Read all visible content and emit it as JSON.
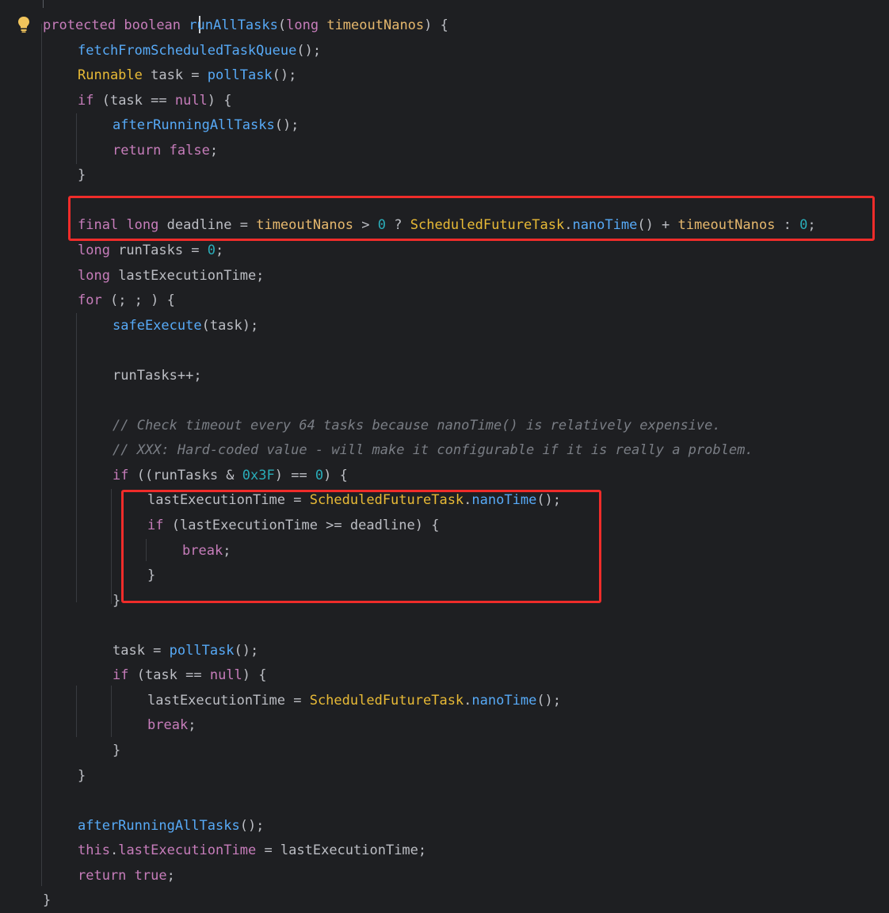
{
  "code_lines": [
    {
      "indent": 0,
      "tokens": [
        [
          "kw2",
          "protected"
        ],
        [
          "plain",
          " "
        ],
        [
          "kw2",
          "boolean"
        ],
        [
          "plain",
          " "
        ],
        [
          "fn",
          "runAllTasks"
        ],
        [
          "plain",
          "("
        ],
        [
          "kw2",
          "long"
        ],
        [
          "plain",
          " "
        ],
        [
          "param",
          "timeoutNanos"
        ],
        [
          "plain",
          ") {"
        ]
      ]
    },
    {
      "indent": 1,
      "tokens": [
        [
          "call",
          "fetchFromScheduledTaskQueue"
        ],
        [
          "plain",
          "();"
        ]
      ]
    },
    {
      "indent": 1,
      "tokens": [
        [
          "type",
          "Runnable"
        ],
        [
          "plain",
          " task = "
        ],
        [
          "call",
          "pollTask"
        ],
        [
          "plain",
          "();"
        ]
      ]
    },
    {
      "indent": 1,
      "tokens": [
        [
          "kw2",
          "if"
        ],
        [
          "plain",
          " (task == "
        ],
        [
          "kw2",
          "null"
        ],
        [
          "plain",
          ") {"
        ]
      ]
    },
    {
      "indent": 2,
      "tokens": [
        [
          "call",
          "afterRunningAllTasks"
        ],
        [
          "plain",
          "();"
        ]
      ]
    },
    {
      "indent": 2,
      "tokens": [
        [
          "kw2",
          "return"
        ],
        [
          "plain",
          " "
        ],
        [
          "kw2",
          "false"
        ],
        [
          "plain",
          ";"
        ]
      ]
    },
    {
      "indent": 1,
      "tokens": [
        [
          "plain",
          "}"
        ]
      ]
    },
    {
      "indent": 1,
      "tokens": []
    },
    {
      "indent": 1,
      "tokens": [
        [
          "kw2",
          "final"
        ],
        [
          "plain",
          " "
        ],
        [
          "kw2",
          "long"
        ],
        [
          "plain",
          " deadline = "
        ],
        [
          "param",
          "timeoutNanos"
        ],
        [
          "plain",
          " > "
        ],
        [
          "num",
          "0"
        ],
        [
          "plain",
          " ? "
        ],
        [
          "type",
          "ScheduledFutureTask"
        ],
        [
          "plain",
          "."
        ],
        [
          "call",
          "nanoTime"
        ],
        [
          "plain",
          "() + "
        ],
        [
          "param",
          "timeoutNanos"
        ],
        [
          "plain",
          " : "
        ],
        [
          "num",
          "0"
        ],
        [
          "plain",
          ";"
        ]
      ]
    },
    {
      "indent": 1,
      "tokens": [
        [
          "kw2",
          "long"
        ],
        [
          "plain",
          " runTasks = "
        ],
        [
          "num",
          "0"
        ],
        [
          "plain",
          ";"
        ]
      ]
    },
    {
      "indent": 1,
      "tokens": [
        [
          "kw2",
          "long"
        ],
        [
          "plain",
          " lastExecutionTime;"
        ]
      ]
    },
    {
      "indent": 1,
      "tokens": [
        [
          "kw2",
          "for"
        ],
        [
          "plain",
          " (; ; ) {"
        ]
      ]
    },
    {
      "indent": 2,
      "tokens": [
        [
          "call",
          "safeExecute"
        ],
        [
          "plain",
          "(task);"
        ]
      ]
    },
    {
      "indent": 2,
      "tokens": []
    },
    {
      "indent": 2,
      "tokens": [
        [
          "plain",
          "runTasks++;"
        ]
      ]
    },
    {
      "indent": 2,
      "tokens": []
    },
    {
      "indent": 2,
      "tokens": [
        [
          "comment",
          "// Check timeout every 64 tasks because nanoTime() is relatively expensive."
        ]
      ]
    },
    {
      "indent": 2,
      "tokens": [
        [
          "comment",
          "// XXX: Hard-coded value - will make it configurable if it is really a problem."
        ]
      ]
    },
    {
      "indent": 2,
      "tokens": [
        [
          "kw2",
          "if"
        ],
        [
          "plain",
          " ((runTasks & "
        ],
        [
          "num",
          "0x3F"
        ],
        [
          "plain",
          ") == "
        ],
        [
          "num",
          "0"
        ],
        [
          "plain",
          ") {"
        ]
      ]
    },
    {
      "indent": 3,
      "tokens": [
        [
          "plain",
          "lastExecutionTime = "
        ],
        [
          "type",
          "ScheduledFutureTask"
        ],
        [
          "plain",
          "."
        ],
        [
          "call",
          "nanoTime"
        ],
        [
          "plain",
          "();"
        ]
      ]
    },
    {
      "indent": 3,
      "tokens": [
        [
          "kw2",
          "if"
        ],
        [
          "plain",
          " (lastExecutionTime >= deadline) {"
        ]
      ]
    },
    {
      "indent": 4,
      "tokens": [
        [
          "kw2",
          "break"
        ],
        [
          "plain",
          ";"
        ]
      ]
    },
    {
      "indent": 3,
      "tokens": [
        [
          "plain",
          "}"
        ]
      ]
    },
    {
      "indent": 2,
      "tokens": [
        [
          "plain",
          "}"
        ]
      ]
    },
    {
      "indent": 2,
      "tokens": []
    },
    {
      "indent": 2,
      "tokens": [
        [
          "plain",
          "task = "
        ],
        [
          "call",
          "pollTask"
        ],
        [
          "plain",
          "();"
        ]
      ]
    },
    {
      "indent": 2,
      "tokens": [
        [
          "kw2",
          "if"
        ],
        [
          "plain",
          " (task == "
        ],
        [
          "kw2",
          "null"
        ],
        [
          "plain",
          ") {"
        ]
      ]
    },
    {
      "indent": 3,
      "tokens": [
        [
          "plain",
          "lastExecutionTime = "
        ],
        [
          "type",
          "ScheduledFutureTask"
        ],
        [
          "plain",
          "."
        ],
        [
          "call",
          "nanoTime"
        ],
        [
          "plain",
          "();"
        ]
      ]
    },
    {
      "indent": 3,
      "tokens": [
        [
          "kw2",
          "break"
        ],
        [
          "plain",
          ";"
        ]
      ]
    },
    {
      "indent": 2,
      "tokens": [
        [
          "plain",
          "}"
        ]
      ]
    },
    {
      "indent": 1,
      "tokens": [
        [
          "plain",
          "}"
        ]
      ]
    },
    {
      "indent": 1,
      "tokens": []
    },
    {
      "indent": 1,
      "tokens": [
        [
          "call",
          "afterRunningAllTasks"
        ],
        [
          "plain",
          "();"
        ]
      ]
    },
    {
      "indent": 1,
      "tokens": [
        [
          "kw2",
          "this"
        ],
        [
          "plain",
          "."
        ],
        [
          "field",
          "lastExecutionTime"
        ],
        [
          "plain",
          " = lastExecutionTime;"
        ]
      ]
    },
    {
      "indent": 1,
      "tokens": [
        [
          "kw2",
          "return"
        ],
        [
          "plain",
          " "
        ],
        [
          "kw2",
          "true"
        ],
        [
          "plain",
          ";"
        ]
      ]
    },
    {
      "indent": 0,
      "tokens": [
        [
          "plain",
          "}"
        ]
      ]
    }
  ],
  "icons": {
    "gutter": "lightbulb-icon"
  },
  "colors": {
    "background": "#1e1f22",
    "highlight": "#ef2c2a",
    "keyword": "#c77dbb",
    "function": "#56a8f5",
    "type": "#e8ba36",
    "number": "#2aacb8",
    "comment": "#7a7e85"
  }
}
